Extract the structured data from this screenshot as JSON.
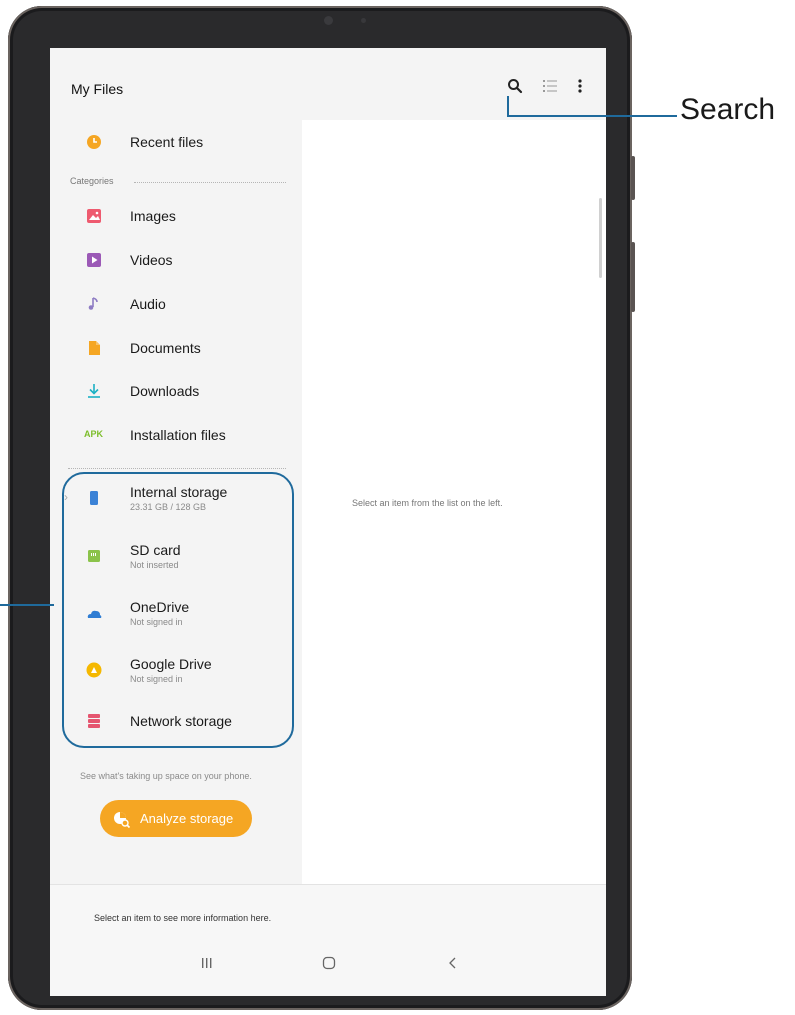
{
  "app": {
    "title": "My Files"
  },
  "toolbar": {
    "search_icon": "search-icon",
    "list_view_icon": "list-view-icon",
    "more_icon": "more-options-icon"
  },
  "recent": {
    "label": "Recent files",
    "icon": "clock-icon",
    "color": "#f5a623"
  },
  "categories": {
    "heading": "Categories",
    "items": [
      {
        "label": "Images",
        "icon": "image-icon",
        "color": "#ee5a6f"
      },
      {
        "label": "Videos",
        "icon": "video-icon",
        "color": "#9b59b6"
      },
      {
        "label": "Audio",
        "icon": "music-note-icon",
        "color": "#8e7cc3"
      },
      {
        "label": "Documents",
        "icon": "document-icon",
        "color": "#f5a623"
      },
      {
        "label": "Downloads",
        "icon": "download-icon",
        "color": "#1ab1c4"
      },
      {
        "label": "Installation files",
        "icon": "apk-icon",
        "color": "#7cbd2a"
      }
    ]
  },
  "storage": [
    {
      "label": "Internal storage",
      "sub": "23.31 GB / 128 GB",
      "icon": "phone-icon",
      "color": "#3b82d6"
    },
    {
      "label": "SD card",
      "sub": "Not inserted",
      "icon": "sd-card-icon",
      "color": "#8bc34a"
    },
    {
      "label": "OneDrive",
      "sub": "Not signed in",
      "icon": "onedrive-icon",
      "color": "#2f7dd3"
    },
    {
      "label": "Google Drive",
      "sub": "Not signed in",
      "icon": "google-drive-icon",
      "color": "#f5b800"
    },
    {
      "label": "Network storage",
      "sub": "",
      "icon": "network-storage-icon",
      "color": "#e5556f"
    }
  ],
  "analyze": {
    "hint": "See what's taking up space on your phone.",
    "button_label": "Analyze storage",
    "color": "#f5a623"
  },
  "detail": {
    "empty_message": "Select an item from the list on the left."
  },
  "info_bar": {
    "message": "Select an item to see more information here."
  },
  "navbar": {
    "recents_icon": "recents-icon",
    "home_icon": "home-icon",
    "back_icon": "back-icon"
  },
  "callouts": {
    "search": "Search"
  },
  "colors": {
    "accent": "#1f6a9c"
  }
}
